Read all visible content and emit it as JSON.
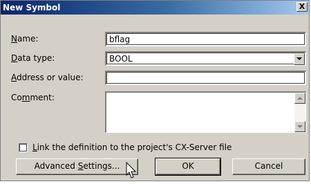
{
  "dialog": {
    "title": "New Symbol",
    "close_label": "X"
  },
  "fields": {
    "name": {
      "label_prefix": "",
      "label_access": "N",
      "label_rest": "ame:",
      "value": "bflag"
    },
    "data_type": {
      "label_prefix": "",
      "label_access": "D",
      "label_rest": "ata type:",
      "value": "BOOL"
    },
    "address": {
      "label_prefix": "",
      "label_access": "A",
      "label_rest": "ddress or value:",
      "value": ""
    },
    "comment": {
      "label_prefix": "Co",
      "label_access": "m",
      "label_rest": "ment:",
      "value": ""
    }
  },
  "link_checkbox": {
    "checked": false,
    "label_access": "L",
    "label_rest": "ink the definition to the project's CX-Server file"
  },
  "buttons": {
    "advanced_prefix": "Advanced ",
    "advanced_access": "S",
    "advanced_rest": "ettings...",
    "ok": "OK",
    "cancel": "Cancel"
  },
  "colors": {
    "title_gradient_start": "#0a246a",
    "title_gradient_end": "#a6caf0",
    "face": "#d4d0c8"
  }
}
